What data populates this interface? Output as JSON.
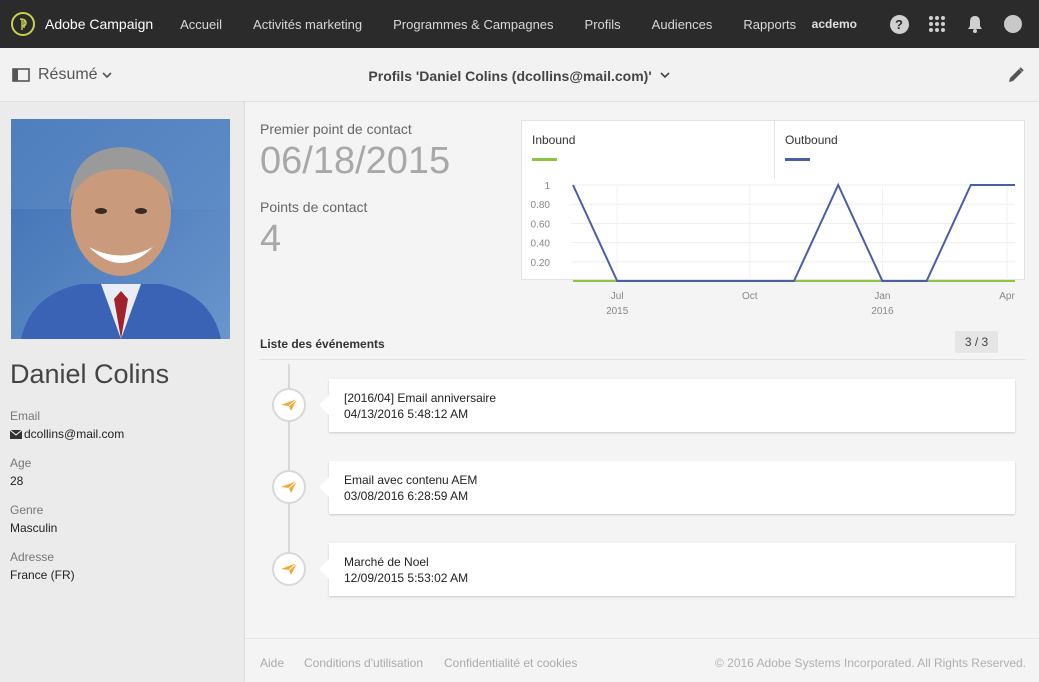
{
  "app": {
    "brand": "Adobe Campaign"
  },
  "nav": {
    "items": [
      {
        "label": "Accueil"
      },
      {
        "label": "Activités marketing"
      },
      {
        "label": "Programmes & Campagnes"
      },
      {
        "label": "Profils"
      },
      {
        "label": "Audiences"
      },
      {
        "label": "Rapports"
      }
    ],
    "user": "acdemo",
    "icons": [
      "help-icon",
      "apps-grid-icon",
      "bell-icon",
      "user-avatar-icon"
    ]
  },
  "subheader": {
    "summary_label": "Résumé",
    "title": "Profils 'Daniel Colins (dcollins@mail.com)'"
  },
  "profile": {
    "name": "Daniel Colins",
    "fields": [
      {
        "label": "Email",
        "value": "dcollins@mail.com"
      },
      {
        "label": "Age",
        "value": "28"
      },
      {
        "label": "Genre",
        "value": "Masculin"
      },
      {
        "label": "Adresse",
        "value": "France (FR)"
      }
    ]
  },
  "stats": {
    "first_contact_label": "Premier point de contact",
    "first_contact_value": "06/18/2015",
    "contacts_label": "Points de contact",
    "contacts_value": "4"
  },
  "chart_data": {
    "type": "line",
    "legend": [
      {
        "name": "Inbound",
        "color": "#8cc53f"
      },
      {
        "name": "Outbound",
        "color": "#4a5ea8"
      }
    ],
    "yticks": [
      "1",
      "0.80",
      "0.60",
      "0.40",
      "0.20"
    ],
    "ylim": [
      0,
      1
    ],
    "xticks": [
      {
        "label": "Jul",
        "sub": "2015"
      },
      {
        "label": "Oct",
        "sub": ""
      },
      {
        "label": "Jan",
        "sub": "2016"
      },
      {
        "label": "Apr",
        "sub": ""
      }
    ],
    "series": [
      {
        "name": "Outbound",
        "values": [
          1,
          0,
          0,
          0,
          0,
          0,
          1,
          0,
          0,
          1,
          1
        ]
      },
      {
        "name": "Inbound",
        "values": [
          0,
          0,
          0,
          0,
          0,
          0,
          0,
          0,
          0,
          0,
          0
        ]
      }
    ],
    "x_positions_months": [
      0,
      1,
      2,
      3,
      4,
      5,
      6,
      7,
      8,
      9,
      10
    ]
  },
  "events": {
    "title": "Liste des événements",
    "count": "3 / 3",
    "items": [
      {
        "name": "[2016/04] Email anniversaire",
        "date": "04/13/2016 5:48:12 AM"
      },
      {
        "name": "Email avec contenu AEM",
        "date": "03/08/2016 6:28:59 AM"
      },
      {
        "name": "Marché de Noel",
        "date": "12/09/2015 5:53:02 AM"
      }
    ]
  },
  "footer": {
    "links": [
      "Aide",
      "Conditions d'utilisation",
      "Confidentialité et cookies"
    ],
    "copyright": "© 2016 Adobe Systems Incorporated. All Rights Reserved."
  }
}
